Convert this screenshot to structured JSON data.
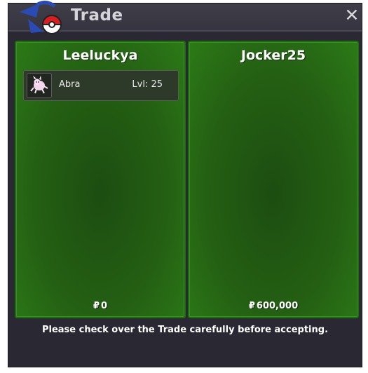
{
  "window": {
    "title": "Trade",
    "close_icon": "close-x-icon"
  },
  "players": [
    {
      "name": "Leeluckya",
      "pokemon": [
        {
          "name": "Abra",
          "level": "Lvl: 25",
          "icon": "abra-sprite-icon"
        }
      ],
      "currency_symbol": "₽",
      "money": "0"
    },
    {
      "name": "Jocker25",
      "pokemon": [],
      "currency_symbol": "₽",
      "money": "600,000"
    }
  ],
  "notice": "Please check over the Trade carefully before accepting.",
  "colors": {
    "panel_green": "#2c7a17",
    "window_bg": "#2a2933"
  }
}
